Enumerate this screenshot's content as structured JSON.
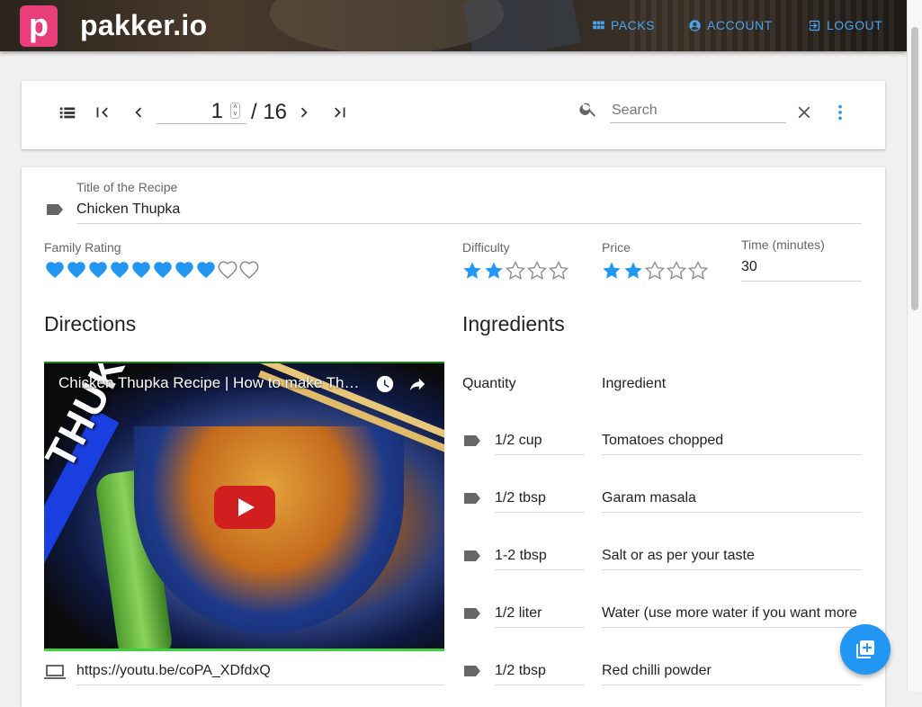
{
  "header": {
    "logo_letter": "p",
    "brand": "pakker.io",
    "nav": [
      {
        "label": "PACKS",
        "icon": "grid-icon"
      },
      {
        "label": "ACCOUNT",
        "icon": "account-circle-icon"
      },
      {
        "label": "LOGOUT",
        "icon": "logout-icon"
      }
    ],
    "accent_color": "#4aa3f0"
  },
  "toolbar": {
    "current_page": "1",
    "total_pages": "/ 16",
    "search_placeholder": "Search"
  },
  "recipe": {
    "title_label": "Title of the Recipe",
    "title_value": "Chicken Thupka",
    "family_rating_label": "Family Rating",
    "family_rating": 8,
    "family_rating_max": 10,
    "difficulty_label": "Difficulty",
    "difficulty": 2,
    "difficulty_max": 5,
    "price_label": "Price",
    "price": 2,
    "price_max": 5,
    "time_label": "Time (minutes)",
    "time_value": "30",
    "directions_title": "Directions",
    "video": {
      "title": "Chicken Thupka Recipe | How to make Th…",
      "thumbnail_text": "THUKPA",
      "url": "https://youtu.be/coPA_XDfdxQ"
    },
    "ingredients_title": "Ingredients",
    "quantity_header": "Quantity",
    "ingredient_header": "Ingredient",
    "ingredients": [
      {
        "qty": "1/2 cup",
        "name": "Tomatoes chopped"
      },
      {
        "qty": "1/2 tbsp",
        "name": "Garam masala"
      },
      {
        "qty": "1-2 tbsp",
        "name": "Salt or as per your taste"
      },
      {
        "qty": "1/2 liter",
        "name": "Water (use more water if you want more"
      },
      {
        "qty": "1/2 tbsp",
        "name": "Red chilli powder"
      }
    ]
  },
  "colors": {
    "rating_blue": "#2196f3",
    "fab": "#2196f3"
  }
}
